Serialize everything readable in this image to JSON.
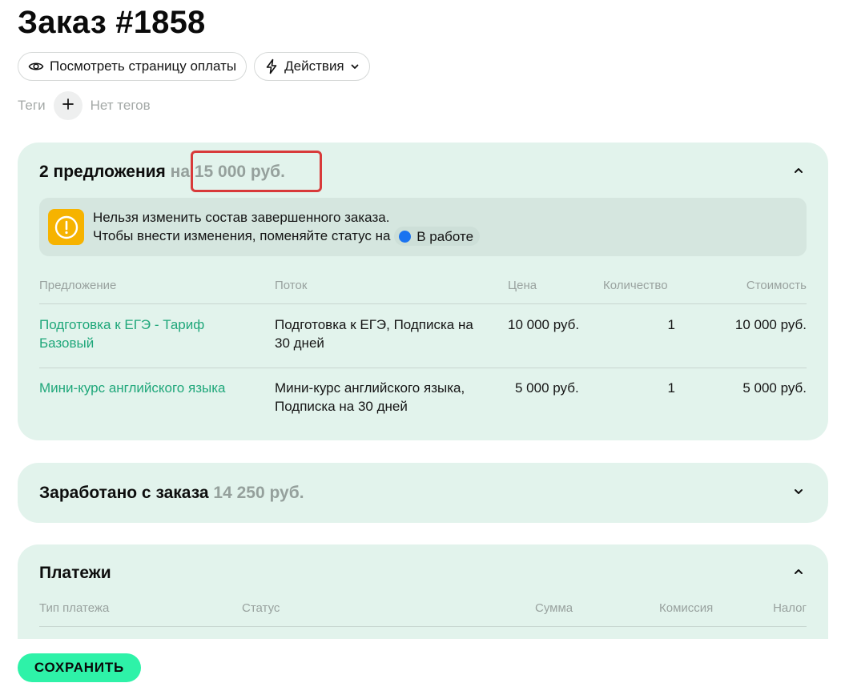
{
  "page": {
    "title": "Заказ #1858"
  },
  "actions": {
    "view_payment_page": "Посмотреть страницу оплаты",
    "actions_menu": "Действия"
  },
  "tags": {
    "label": "Теги",
    "empty": "Нет тегов"
  },
  "offers": {
    "title": "2 предложения",
    "total": "на 15 000 руб.",
    "notice_line1": "Нельзя изменить состав завершенного заказа.",
    "notice_line2": "Чтобы внести изменения, поменяйте статус на",
    "status_label": "В работе",
    "status_color": "#1a73f0",
    "columns": {
      "offer": "Предложение",
      "stream": "Поток",
      "price": "Цена",
      "qty": "Количество",
      "cost": "Стоимость"
    },
    "rows": [
      {
        "offer": "Подготовка к ЕГЭ - Тариф Базовый",
        "stream": "Подготовка к ЕГЭ, Подписка на 30 дней",
        "price": "10 000 руб.",
        "qty": "1",
        "cost": "10 000 руб."
      },
      {
        "offer": "Мини-курс английского языка",
        "stream": "Мини-курс английского языка, Подписка на 30 дней",
        "price": "5 000 руб.",
        "qty": "1",
        "cost": "5 000 руб."
      }
    ]
  },
  "earned": {
    "title": "Заработано с заказа",
    "amount": "14 250 руб."
  },
  "payments": {
    "title": "Платежи",
    "columns": {
      "type": "Тип платежа",
      "status": "Статус",
      "amount": "Сумма",
      "fee": "Комиссия",
      "tax": "Налог"
    }
  },
  "footer": {
    "save_label": "СОХРАНИТЬ"
  },
  "colors": {
    "card_bg": "#e2f3ec",
    "link": "#1fa77a",
    "warning": "#f6b300",
    "save_button": "#2ef2a8",
    "highlight": "#d83a3a"
  }
}
